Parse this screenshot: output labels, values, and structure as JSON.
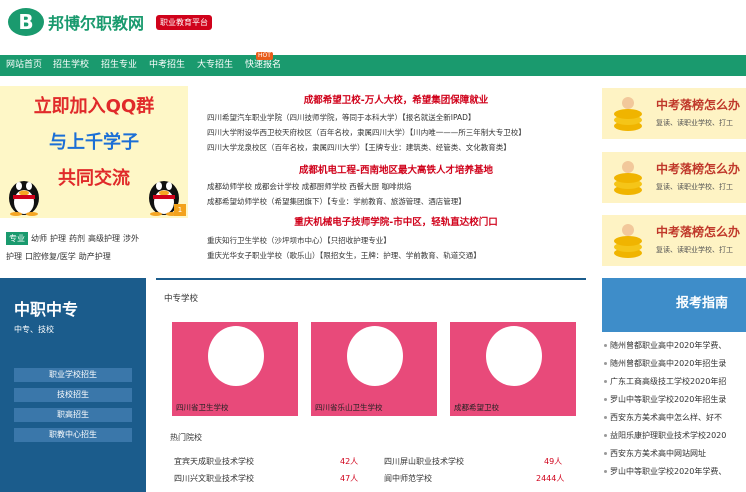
{
  "header": {
    "logo_mark": "B",
    "logo_text": "邦博尔职教网",
    "logo_tag": "职业教育平台"
  },
  "nav": {
    "items": [
      "网站首页",
      "招生学校",
      "招生专业",
      "中考招生",
      "大专招生",
      "快速报名"
    ],
    "hot": "HOT"
  },
  "qq_banner": {
    "line1": "立即加入QQ群",
    "line2": "与上千学子",
    "line3": "共同交流",
    "corner": "1"
  },
  "tags": [
    "专业",
    "幼师",
    "护理",
    "药剂",
    "高级护理",
    "涉外",
    "护理",
    "口腔修复/医学",
    "助产护理"
  ],
  "news": {
    "head1": "成都希望卫校-万人大校，希望集团保障就业",
    "line1": "四川希望汽车职业学院（四川技师学院，等同于本科大学）【报名就送全新IPAD】",
    "line2": "四川大学附设华西卫校天府校区（百年名校，隶属四川大学）【川内唯一——所三年制大专卫校】",
    "line3": "四川大学龙泉校区（百年名校，隶属四川大学）【王牌专业：建筑类、经管类、文化教育类】",
    "head2": "成都机电工程-西南地区最大高铁人才培养基地",
    "line4": "成都幼师学校  成都会计学校  成都厨师学校  西餐大厨  咖啡烘焙",
    "line5": "成都希望幼师学校（希望集团旗下）【专业：学前教育、旅游管理、酒店管理】",
    "head3": "重庆机械电子技师学院-市中区，轻轨直达校门口",
    "line6": "重庆知行卫生学校（沙坪坝市中心）【只招收护理专业】",
    "line7": "重庆光华女子职业学校（歌乐山）【限招女生，王牌：护理、学前教育、轨道交通】"
  },
  "ads": {
    "title": "中考落榜怎么办",
    "sub": "复读、读职业学校、打工"
  },
  "zz": {
    "title": "中职中专",
    "sub": "中专、技校",
    "buttons": [
      "职业学校招生",
      "技校招生",
      "职高招生",
      "职教中心招生"
    ]
  },
  "center": {
    "title": "中专学校",
    "cards": [
      "四川省卫生学校",
      "四川省乐山卫生学校",
      "成都希望卫校"
    ],
    "hot_title": "热门院校",
    "hot": [
      {
        "name": "宜宾天成职业技术学校",
        "count": "42人"
      },
      {
        "name": "四川屏山职业技术学校",
        "count": "49人"
      },
      {
        "name": "四川兴文职业技术学校",
        "count": "47人"
      },
      {
        "name": "阆中师范学校",
        "count": "2444人"
      }
    ]
  },
  "bk": {
    "title": "报考指南",
    "items": [
      "随州曾都职业高中2020年学费、",
      "随州曾都职业高中2020年招生录",
      "广东工商高级技工学校2020年招",
      "罗山中等职业学校2020年招生录",
      "西安东方美术高中怎么样、好不",
      "益阳乐康护理职业技术学校2020",
      "西安东方美术高中网站网址",
      "罗山中等职业学校2020年学费、"
    ]
  },
  "colors": {
    "brand": "#1a9a6e",
    "accent_red": "#d0021b",
    "blue": "#1b5c8c"
  }
}
